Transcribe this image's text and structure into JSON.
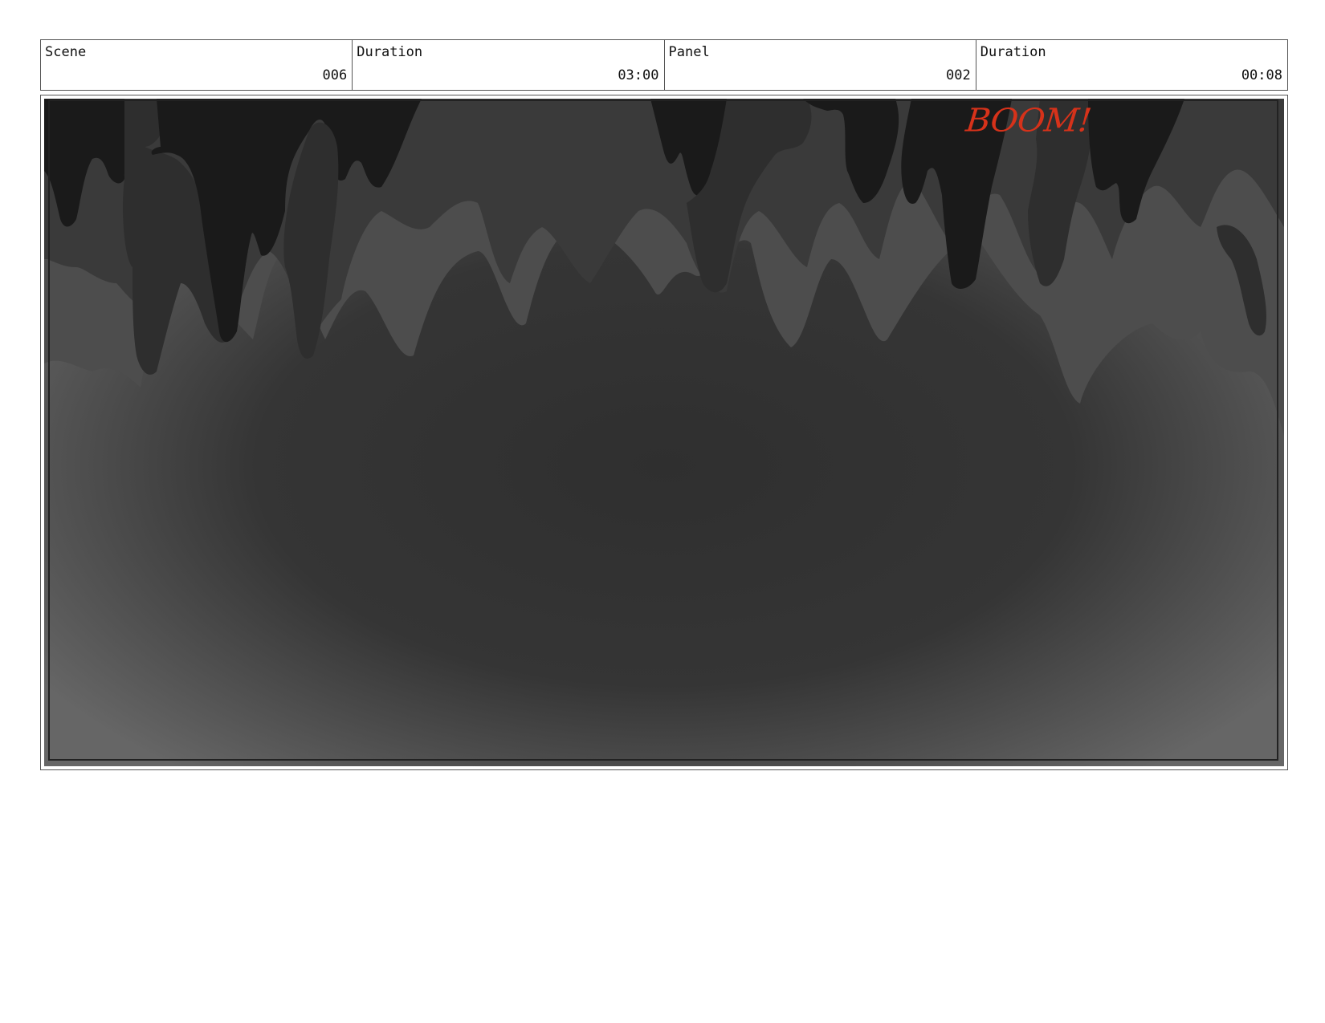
{
  "header": {
    "cells": [
      {
        "label": "Scene",
        "value": "006"
      },
      {
        "label": "Duration",
        "value": "03:00"
      },
      {
        "label": "Panel",
        "value": "002"
      },
      {
        "label": "Duration",
        "value": "00:08"
      }
    ]
  },
  "panel": {
    "annotation_text": "BOOM!",
    "annotation_color": "#d6321a",
    "scene_description": "",
    "colors": {
      "darkest": "#1a1a1a",
      "dark": "#2e2e2e",
      "mid": "#4a4a4a",
      "light": "#666666"
    }
  }
}
